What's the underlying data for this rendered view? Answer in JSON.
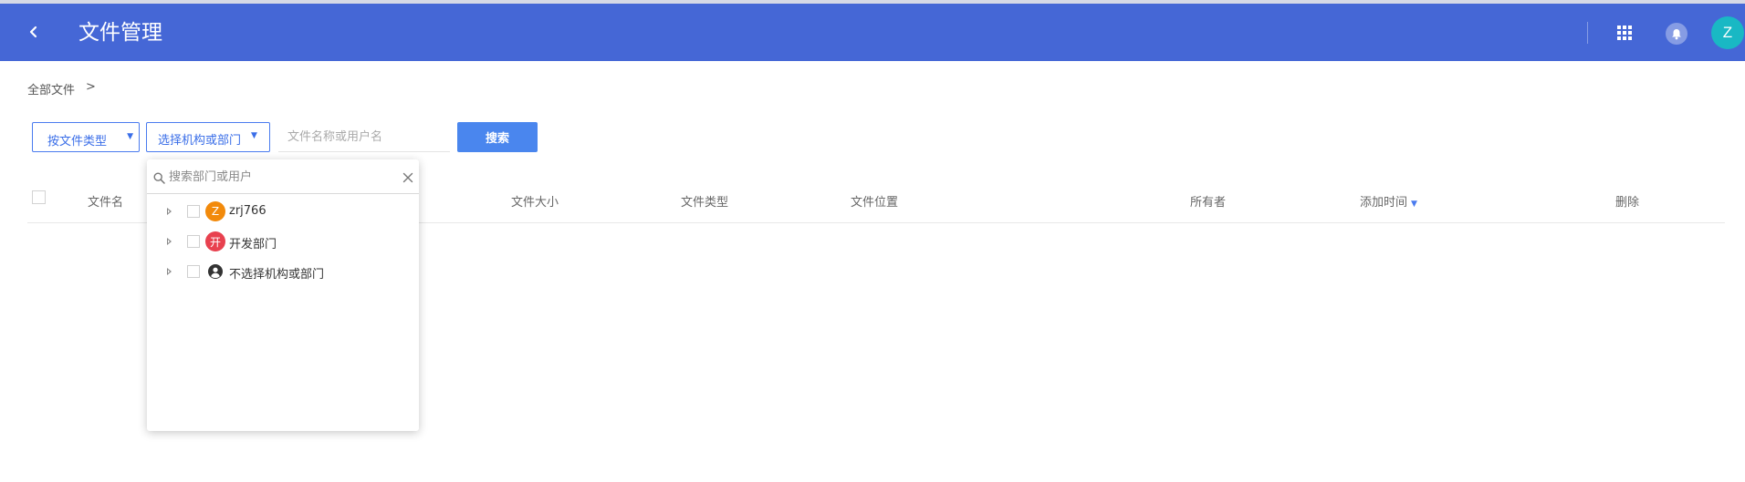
{
  "header": {
    "title": "文件管理",
    "avatar_letter": "Z",
    "bg_color": "#4567d6",
    "avatar_color": "#19b8c4"
  },
  "breadcrumb": {
    "root": "全部文件",
    "separator": ">"
  },
  "filters": {
    "file_type_label": "按文件类型",
    "file_type_caret": "▼",
    "org_label": "选择机构或部门",
    "org_caret": "▼",
    "search_placeholder": "文件名称或用户名",
    "search_value": "",
    "search_button": "搜索"
  },
  "table": {
    "columns": [
      "文件名",
      "文件大小",
      "文件类型",
      "文件位置",
      "所有者",
      "添加时间",
      "删除"
    ],
    "sort_caret": "▼",
    "rows": []
  },
  "org_dropdown": {
    "search_placeholder": "搜索部门或用户",
    "search_value": "",
    "items": [
      {
        "label": "zrj766",
        "avatar_text": "Z",
        "avatar_color": "#f28a0b",
        "icon": "letter-avatar"
      },
      {
        "label": "开发部门",
        "avatar_text": "开",
        "avatar_color": "#e8414f",
        "icon": "letter-avatar"
      },
      {
        "label": "不选择机构或部门",
        "avatar_text": "",
        "avatar_color": "#333333",
        "icon": "user-circle-icon"
      }
    ]
  }
}
